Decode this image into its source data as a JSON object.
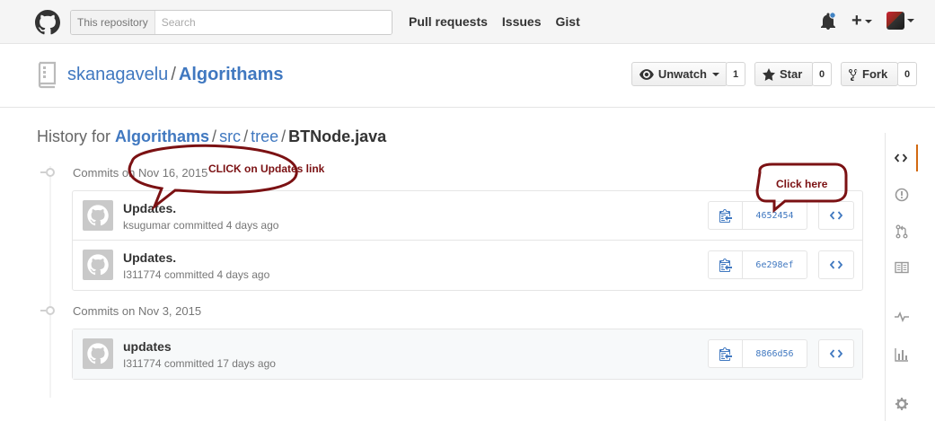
{
  "header": {
    "search_scope": "This repository",
    "search_placeholder": "Search",
    "nav": [
      "Pull requests",
      "Issues",
      "Gist"
    ]
  },
  "repo": {
    "owner": "skanagavelu",
    "separator": "/",
    "name": "Algorithams",
    "watch_label": "Unwatch",
    "watch_count": "1",
    "star_label": "Star",
    "star_count": "0",
    "fork_label": "Fork",
    "fork_count": "0"
  },
  "history": {
    "prefix": "History for",
    "repo": "Algorithams",
    "path": [
      "src",
      "tree"
    ],
    "file": "BTNode.java"
  },
  "groups": [
    {
      "title": "Commits on Nov 16, 2015",
      "commits": [
        {
          "title": "Updates.",
          "author": "ksugumar",
          "meta": "committed 4 days ago",
          "sha": "4652454"
        },
        {
          "title": "Updates.",
          "author": "I311774",
          "meta": "committed 4 days ago",
          "sha": "6e298ef"
        }
      ]
    },
    {
      "title": "Commits on Nov 3, 2015",
      "commits": [
        {
          "title": "updates",
          "author": "I311774",
          "meta": "committed 17 days ago",
          "sha": "8866d56"
        }
      ]
    }
  ],
  "annotations": {
    "callout_1": "CLICK on Updates link",
    "callout_2": "Click here"
  },
  "sidebar": [
    "code-icon",
    "issue-icon",
    "pull-request-icon",
    "wiki-icon",
    "pulse-icon",
    "graph-icon",
    "settings-icon"
  ],
  "colors": {
    "link": "#4078c0",
    "annotation": "#7b1113",
    "active_tab": "#d26911"
  }
}
